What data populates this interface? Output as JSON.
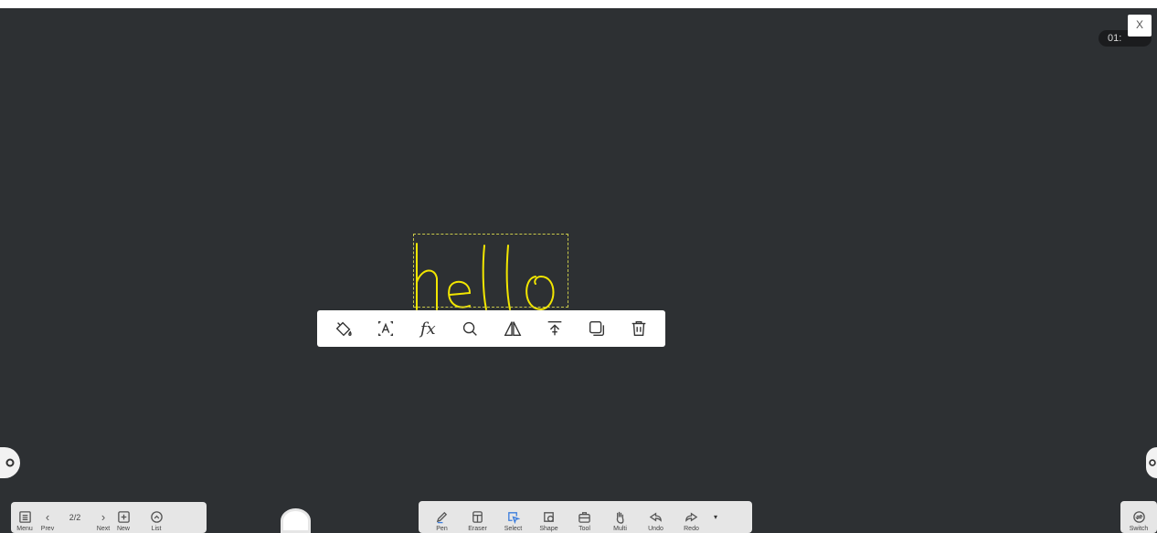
{
  "header": {
    "timer_text": "01:",
    "close_label": "X"
  },
  "canvas": {
    "ink_text": "hello",
    "ink_color": "#f2e600"
  },
  "context_toolbar": {
    "fx_label": "fx",
    "icons": [
      "fill-bucket-icon",
      "text-recognition-icon",
      "formula-icon",
      "search-icon",
      "mirror-icon",
      "bring-to-top-icon",
      "duplicate-icon",
      "trash-icon"
    ]
  },
  "nav": {
    "menu_label": "Menu",
    "prev_label": "Prev",
    "page_indicator": "2/2",
    "next_label": "Next",
    "new_label": "New",
    "list_label": "List"
  },
  "tools": {
    "pen_label": "Pen",
    "eraser_label": "Eraser",
    "select_label": "Select",
    "shape_label": "Shape",
    "tool_label": "Tool",
    "multi_label": "Multi",
    "undo_label": "Undo",
    "redo_label": "Redo",
    "more_glyph": "▾",
    "active_tool": "Select",
    "active_color": "#3b7ddd"
  },
  "switch": {
    "label": "Switch"
  }
}
